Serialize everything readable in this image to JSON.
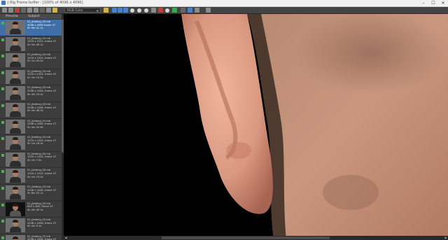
{
  "window": {
    "title": "J Rig Frame buffer - [100% of 4096 x 4096]",
    "minimize": "–",
    "maximize": "☐",
    "close": "✕"
  },
  "toolbar": {
    "view_dropdown": "RGB Color"
  },
  "sidebar": {
    "header_col1": "Preview",
    "header_col2": "Subject",
    "items": [
      {
        "line1": "01_Jiadeng_04 mb",
        "line2": "4096 x 4096 frame 47",
        "line3": "0h 9m 41.1s",
        "selected": true
      },
      {
        "line1": "01_Jiadeng_04 mb",
        "line2": "1024 x 1024, frame 47",
        "line3": "0h 0m 46.1s"
      },
      {
        "line1": "01_Jiadeng_04 mb",
        "line2": "1024 x 1024, frame 47",
        "line3": "0h 1m 05.5s"
      },
      {
        "line1": "01_Jiadeng_04 mb",
        "line2": "1024 x 1024, frame 47",
        "line3": "0h 1m 19.5s"
      },
      {
        "line1": "01_Jiadeng_04 mb",
        "line2": "2048 x 2048, frame 47",
        "line3": "0h 4m 23.2s"
      },
      {
        "line1": "01_Jiadeng_04 mb",
        "line2": "2048 x 2048, frame 47",
        "line3": "0h 4m 46.3s"
      },
      {
        "line1": "01_Jiadeng_04 mb",
        "line2": "2048 x 2048, frame 47",
        "line3": "0h 4m 52.6s"
      },
      {
        "line1": "01_Jiadeng_04 mb",
        "line2": "1024 x 1024, frame 47",
        "line3": "0h 1m 16.5s"
      },
      {
        "line1": "01_Jiadeng_04 mb",
        "line2": "1024 x 1024, frame 47",
        "line3": "0h 1m 7.5s"
      },
      {
        "line1": "01_Jiadeng_04 mb",
        "line2": "1024 x 1024, frame 47",
        "line3": "0h 1m 23.5s"
      },
      {
        "line1": "01_Jiadeng_03 mb",
        "line2": "2048 x 2048, frame 47",
        "line3": "0h 8m 52.1s"
      },
      {
        "line1": "01_Jiadeng_03 mb",
        "line2": "640 x 480, frame 47",
        "line3": "0h 0m 40.1s",
        "dark": true
      },
      {
        "line1": "01_Jiadeng_03 mb",
        "line2": "2048 x 2048, frame 47",
        "line3": "0h 4m 9.1s"
      },
      {
        "line1": "01_Jiadeng_03 mb",
        "line2": "2048 x 2048, frame 47",
        "line3": "0h 4m 11.7s"
      }
    ]
  }
}
